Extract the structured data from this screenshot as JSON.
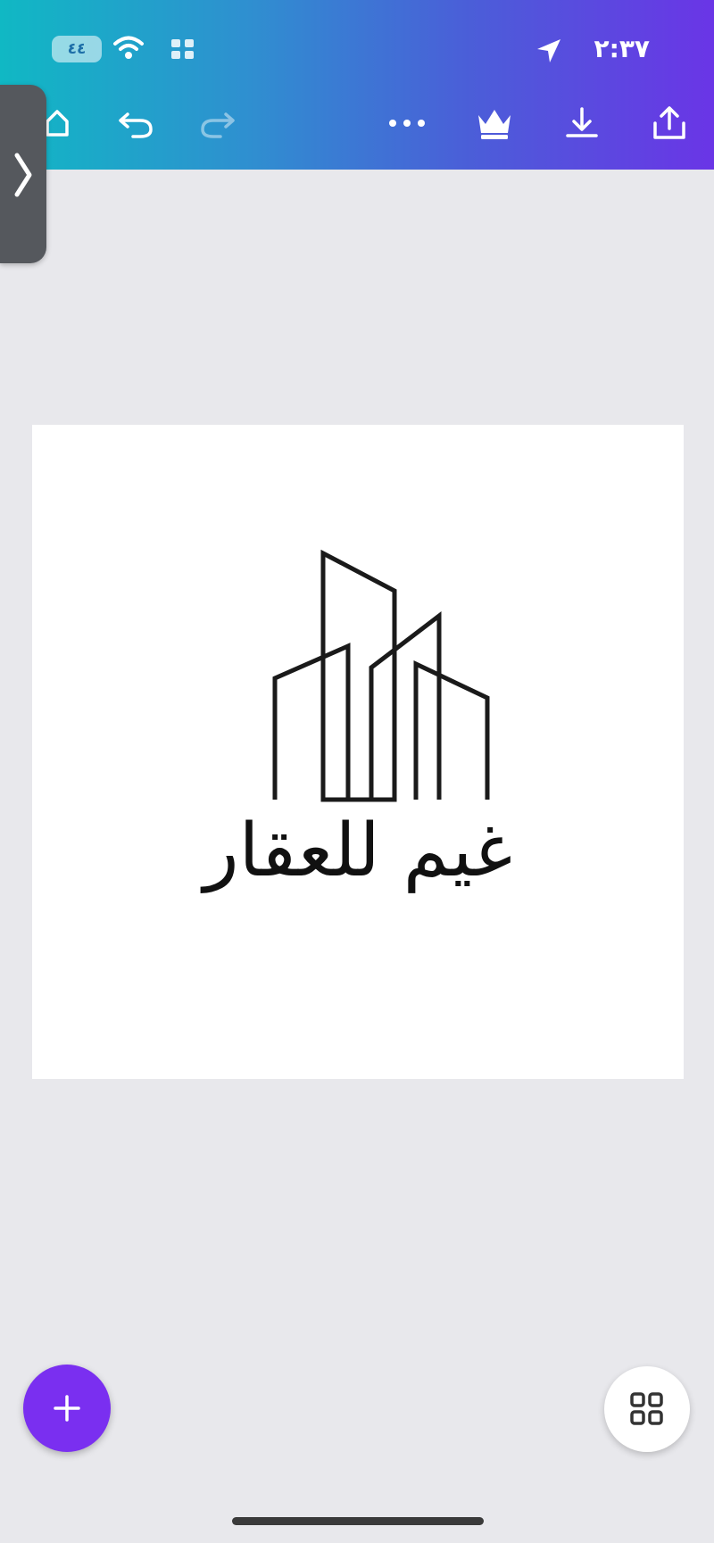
{
  "status_bar": {
    "badge_text": "٤٤",
    "time": "٢:٣٧"
  },
  "toolbar": {
    "icons": [
      "home-icon",
      "undo-icon",
      "redo-icon",
      "more-icon",
      "crown-icon",
      "download-icon",
      "share-icon"
    ]
  },
  "canvas": {
    "logo_text": "غيم للعقار"
  },
  "colors": {
    "gradient_start": "#10b8c4",
    "gradient_end": "#6a35e6",
    "fab": "#7a2ff0"
  }
}
